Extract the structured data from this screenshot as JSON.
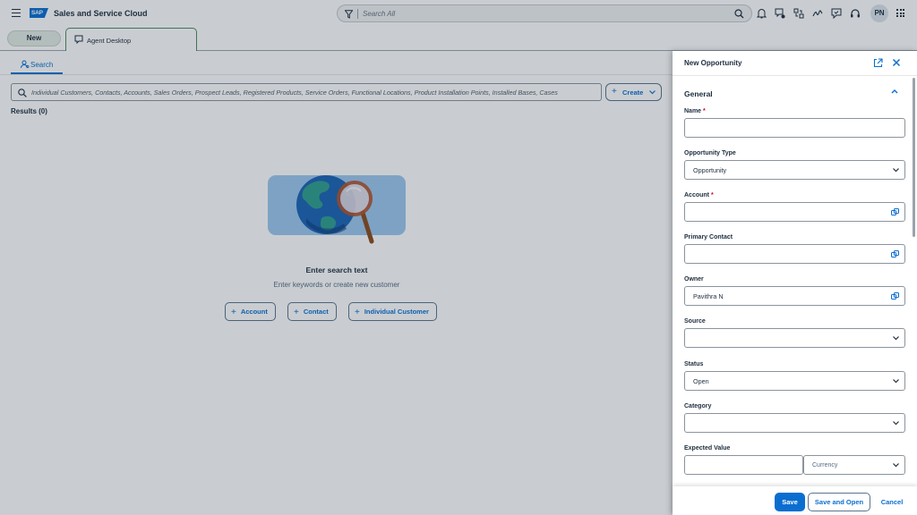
{
  "shell": {
    "logo_text": "SAP",
    "app_title": "Sales and Service Cloud",
    "search_placeholder": "Search All",
    "avatar_initials": "PN"
  },
  "tabs": {
    "new_label": "New",
    "agent_desktop_label": "Agent Desktop"
  },
  "main": {
    "search_tab_label": "Search",
    "search_placeholder": "Individual Customers, Contacts, Accounts, Sales Orders, Prospect Leads, Registered Products, Service Orders, Functional Locations, Product Installation Points, Installed Bases, Cases",
    "create_label": "Create",
    "results_label": "Results (0)",
    "empty_title": "Enter search text",
    "empty_subtitle": "Enter keywords or create new customer",
    "quick_actions": [
      "Account",
      "Contact",
      "Individual Customer"
    ]
  },
  "panel": {
    "title": "New Opportunity",
    "section_title": "General",
    "fields": {
      "name_label": "Name",
      "opportunity_type_label": "Opportunity Type",
      "opportunity_type_value": "Opportunity",
      "account_label": "Account",
      "primary_contact_label": "Primary Contact",
      "owner_label": "Owner",
      "owner_value": "Pavithra N",
      "source_label": "Source",
      "status_label": "Status",
      "status_value": "Open",
      "category_label": "Category",
      "expected_value_label": "Expected Value",
      "currency_placeholder": "Currency",
      "required_marker": "*"
    },
    "footer": {
      "save_label": "Save",
      "save_and_open_label": "Save and Open",
      "cancel_label": "Cancel"
    }
  },
  "colors": {
    "brand": "#0a6ed1",
    "required": "#d0021b",
    "tab_border": "#4d8a5a",
    "overlay": "rgba(29,45,62,0.24)"
  }
}
